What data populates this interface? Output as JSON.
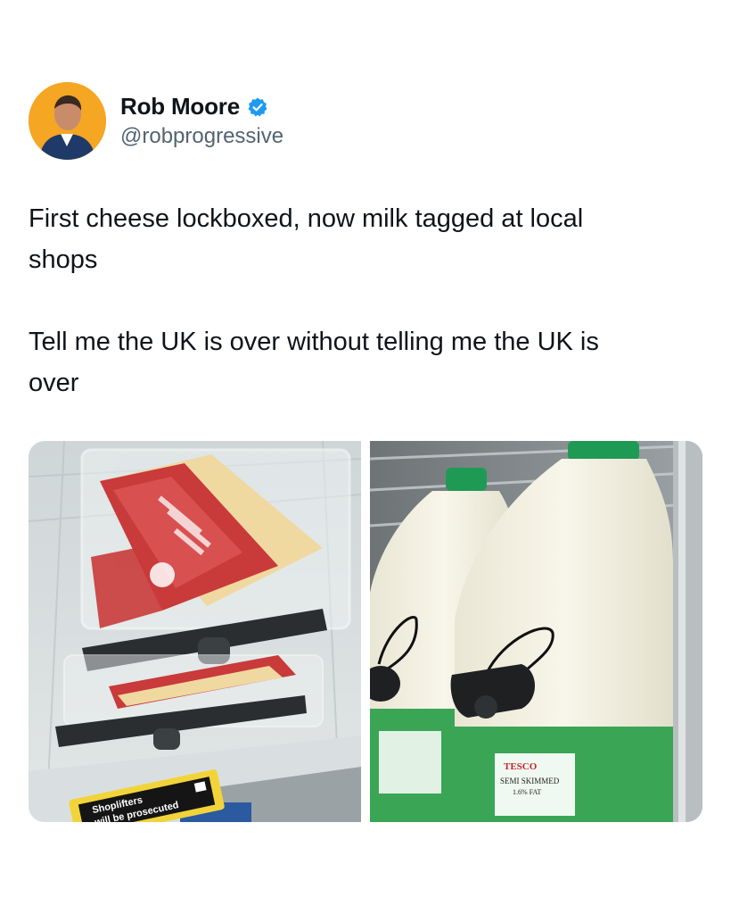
{
  "author": {
    "display_name": "Rob Moore",
    "handle": "@robprogressive",
    "verified": true,
    "avatar_icon": "user-avatar",
    "avatar_bg": "#f5a623"
  },
  "tweet": {
    "text": "First cheese lockboxed, now milk tagged at local\nshops\n\nTell me the UK is over without telling me the UK is\nover"
  },
  "media": {
    "left": {
      "shelf_sign_line1": "Shoplifters",
      "shelf_sign_line2": "will be prosecuted"
    },
    "right": {
      "brand": "TESCO",
      "product": "SEMI SKIMMED",
      "fat": "1.6% FAT"
    }
  },
  "colors": {
    "verified_blue": "#1d9bf0",
    "handle_gray": "#536471"
  }
}
